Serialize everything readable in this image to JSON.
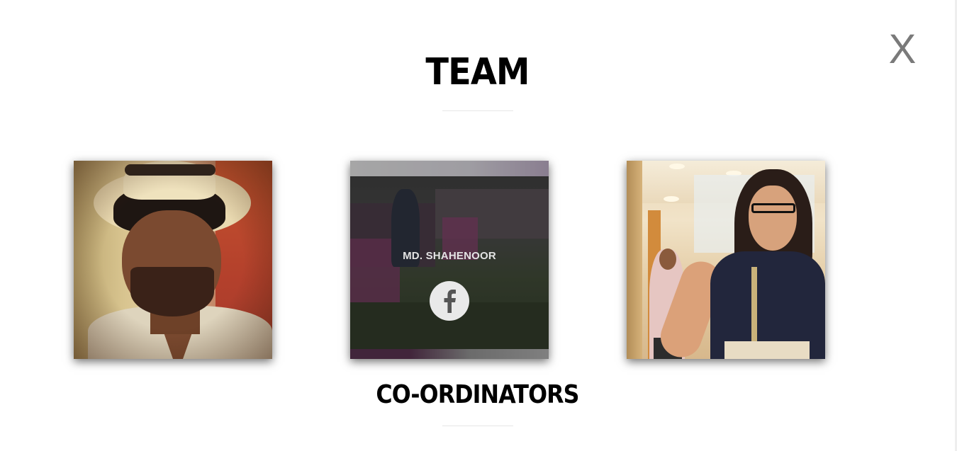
{
  "modal": {
    "close_label": "X",
    "title": "TEAM",
    "subtitle": "CO-ORDINATORS"
  },
  "team_cards": [
    {
      "name": "",
      "social_icon": "none"
    },
    {
      "name": "MD. SHAHENOOR",
      "social_icon": "facebook-icon"
    },
    {
      "name": "",
      "social_icon": "none"
    }
  ],
  "colors": {
    "background": "#ffffff",
    "heading": "#000000",
    "close": "#7a7a7a",
    "rule": "#e6e6e6"
  }
}
